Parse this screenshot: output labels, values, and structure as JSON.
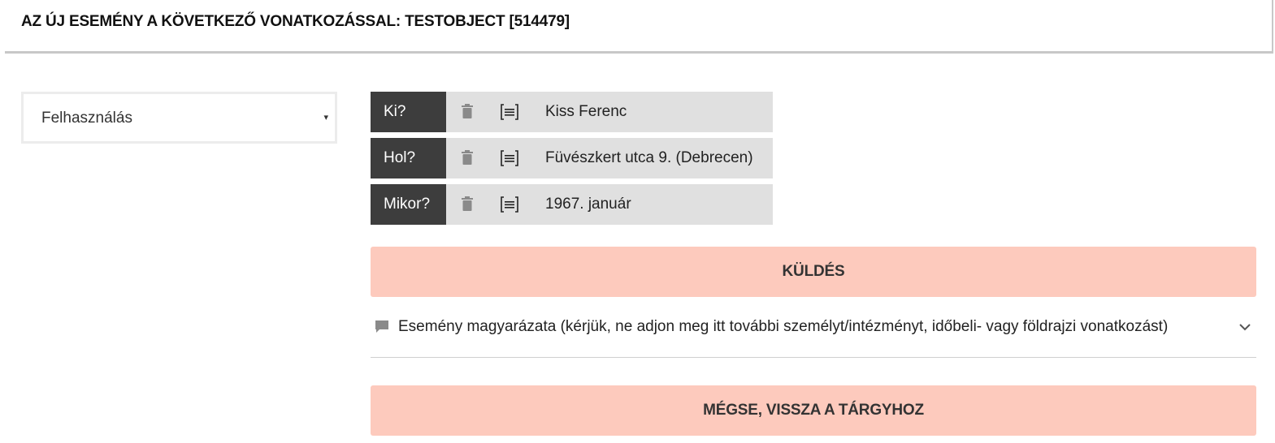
{
  "header": {
    "title": "AZ ÚJ ESEMÉNY A KÖVETKEZŐ VONATKOZÁSSAL: TESTOBJECT [514479]"
  },
  "event_type": {
    "selected": "Felhasználás",
    "caret": "▾"
  },
  "fields": [
    {
      "label": "Ki?",
      "value": "Kiss Ferenc",
      "icons": [
        "trash-icon",
        "details-icon"
      ]
    },
    {
      "label": "Hol?",
      "value": "Füvészkert utca 9. (Debrecen)",
      "icons": [
        "trash-icon",
        "details-icon"
      ]
    },
    {
      "label": "Mikor?",
      "value": "1967. január",
      "icons": [
        "trash-icon",
        "details-icon"
      ]
    }
  ],
  "actions": {
    "submit_label": "KÜLDÉS",
    "cancel_label": "MÉGSE, VISSZA A TÁRGYHOZ"
  },
  "explanation": {
    "label": "Esemény magyarázata (kérjük, ne adjon meg itt további személyt/intézményt, időbeli- vagy földrajzi vonatkozást)",
    "icon": "comment-icon",
    "toggle_icon": "chevron-down-icon"
  },
  "colors": {
    "label_bg": "#3d3d3d",
    "row_bg": "#e0e0e0",
    "button_bg": "#fdcabd",
    "icon_gray": "#8a8a8a"
  }
}
